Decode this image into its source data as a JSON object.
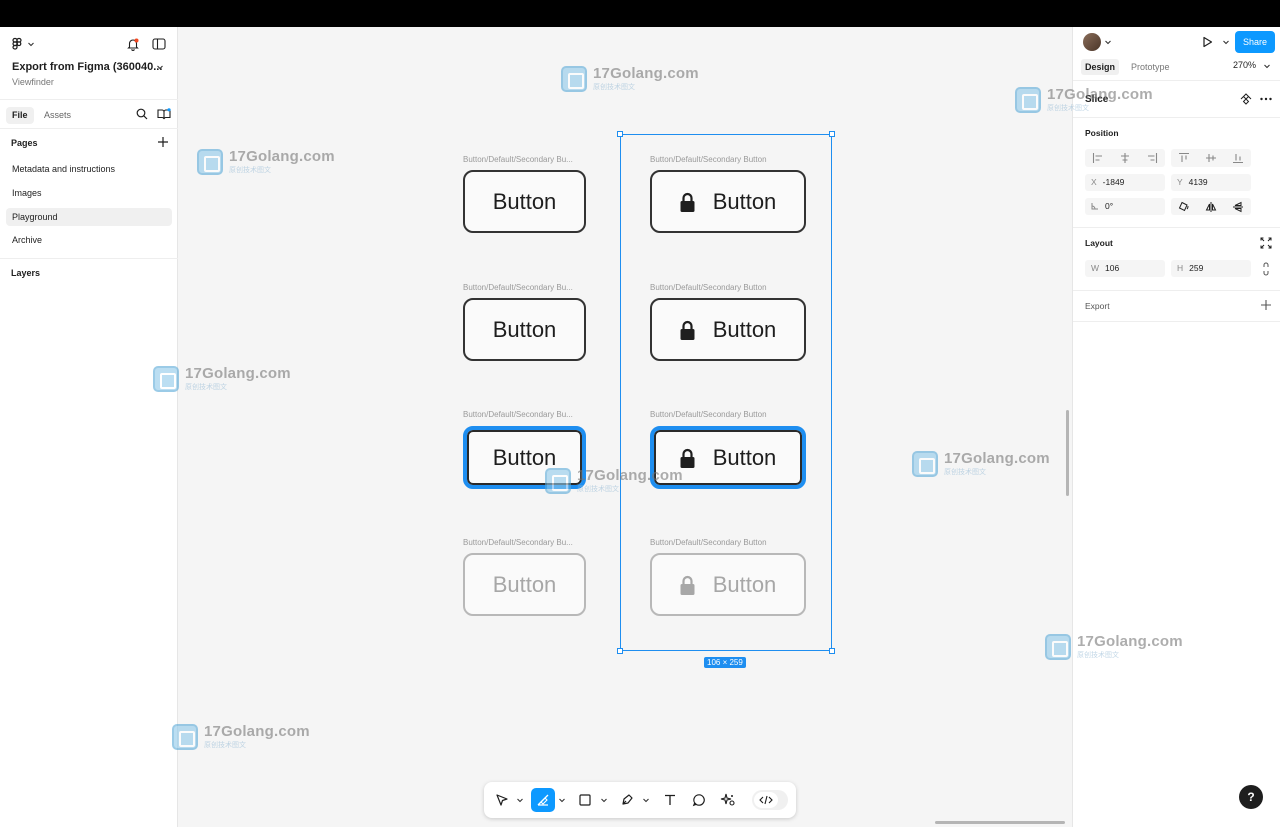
{
  "left_panel": {
    "file_title": "Export from Figma (360040...",
    "file_subtitle": "Viewfinder",
    "tabs": [
      "File",
      "Assets"
    ],
    "pages_header": "Pages",
    "pages": [
      "Metadata and instructions",
      "Images",
      "Playground",
      "Archive"
    ],
    "selected_page": "Playground",
    "layers_header": "Layers"
  },
  "right_panel": {
    "share_label": "Share",
    "tabs": [
      "Design",
      "Prototype"
    ],
    "zoom": "270%",
    "selection_type": "Slice",
    "position_header": "Position",
    "x_label": "X",
    "x_value": "-1849",
    "y_label": "Y",
    "y_value": "4139",
    "rotation_value": "0°",
    "layout_header": "Layout",
    "w_label": "W",
    "w_value": "106",
    "h_label": "H",
    "h_value": "259",
    "export_header": "Export",
    "help": "?"
  },
  "canvas": {
    "frame_label_short": "Button/Default/Secondary Bu...",
    "frame_label_full": "Button/Default/Secondary Button",
    "button_text": "Button",
    "slice_dimensions": "106 × 259"
  },
  "watermark": {
    "name": "17Golang.com",
    "sub": "原创技术图文"
  },
  "colors": {
    "accent": "#0d99ff",
    "selection": "#1e8ef0",
    "focus_ring": "#1e8ef0"
  }
}
